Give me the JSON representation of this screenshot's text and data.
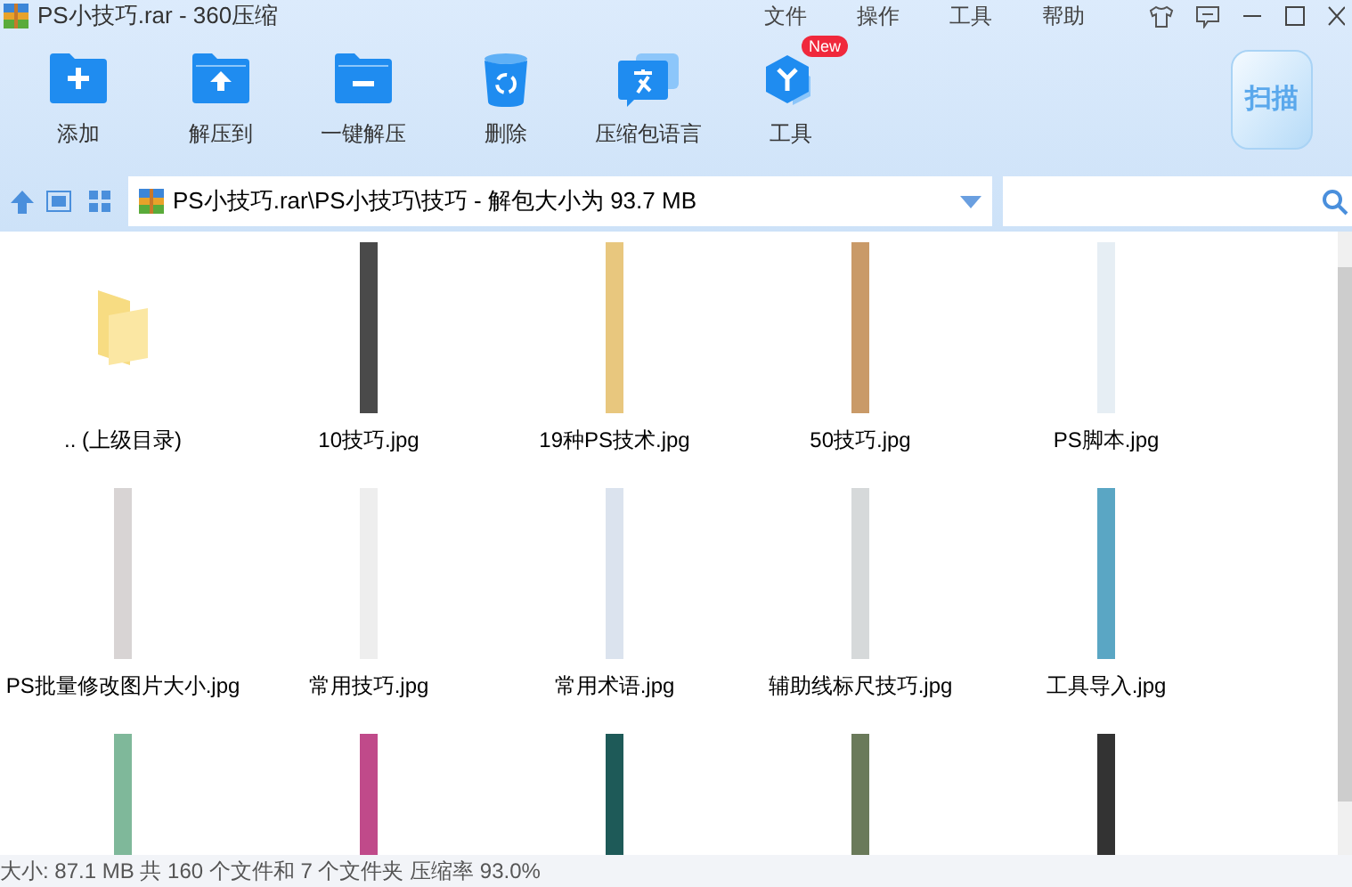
{
  "window": {
    "title": "PS小技巧.rar - 360压缩"
  },
  "menu": [
    "文件",
    "操作",
    "工具",
    "帮助"
  ],
  "toolbar": [
    {
      "kind": "add",
      "label": "添加"
    },
    {
      "kind": "extract",
      "label": "解压到"
    },
    {
      "kind": "oneclick",
      "label": "一键解压"
    },
    {
      "kind": "delete",
      "label": "删除"
    },
    {
      "kind": "language",
      "label": "压缩包语言"
    },
    {
      "kind": "tools",
      "label": "工具",
      "badge": "New"
    }
  ],
  "scan_button": {
    "label": "扫描"
  },
  "address_bar": {
    "path": "PS小技巧.rar\\PS小技巧\\技巧 - 解包大小为 93.7 MB"
  },
  "files": [
    {
      "kind": "folder",
      "name": ".. (上级目录)"
    },
    {
      "kind": "image",
      "name": "10技巧.jpg",
      "color": "#4a4a4a"
    },
    {
      "kind": "image",
      "name": "19种PS技术.jpg",
      "color": "#e8c77e"
    },
    {
      "kind": "image",
      "name": "50技巧.jpg",
      "color": "#c99a68"
    },
    {
      "kind": "image",
      "name": "PS脚本.jpg",
      "color": "#e6eef4"
    },
    {
      "kind": "image",
      "name": "PS批量修改图片大小.jpg",
      "color": "#d8d4d4"
    },
    {
      "kind": "image",
      "name": "常用技巧.jpg",
      "color": "#eeeeee"
    },
    {
      "kind": "image",
      "name": "常用术语.jpg",
      "color": "#dbe3ee"
    },
    {
      "kind": "image",
      "name": "辅助线标尺技巧.jpg",
      "color": "#d6d9da"
    },
    {
      "kind": "image",
      "name": "工具导入.jpg",
      "color": "#5aa6c4"
    },
    {
      "kind": "image",
      "color": "#7fb89a"
    },
    {
      "kind": "image",
      "color": "#c04a8a"
    },
    {
      "kind": "image",
      "color": "#1e5a58"
    },
    {
      "kind": "image",
      "color": "#6a7a5a"
    },
    {
      "kind": "image",
      "color": "#333333"
    }
  ],
  "status_bar": "大小: 87.1 MB 共 160 个文件和 7 个文件夹 压缩率 93.0%"
}
